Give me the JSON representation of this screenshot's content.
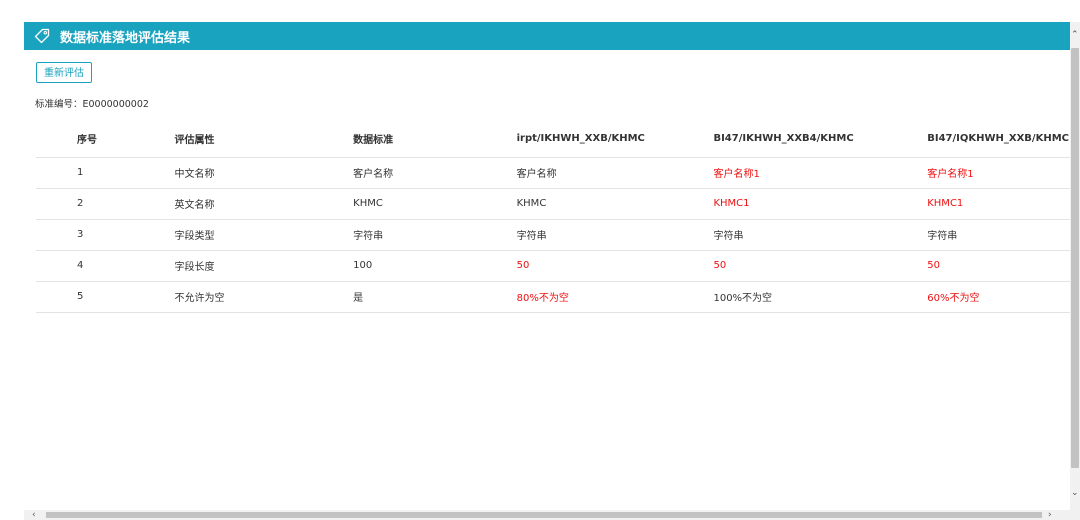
{
  "header": {
    "title": "数据标准落地评估结果",
    "icon": "tag-icon"
  },
  "actions": {
    "reevaluate_label": "重新评估"
  },
  "standard": {
    "code_text": "标准编号：E0000000002"
  },
  "colors": {
    "accent": "#1aa3bf",
    "mismatch": "#ee1111"
  },
  "table": {
    "headers": [
      "序号",
      "评估属性",
      "数据标准",
      "irpt/IKHWH_XXB/KHMC",
      "BI47/IKHWH_XXB4/KHMC",
      "BI47/IQKHWH_XXB/KHMC"
    ],
    "rows": [
      {
        "cells": [
          "1",
          "中文名称",
          "客户名称",
          "客户名称",
          "客户名称1",
          "客户名称1"
        ],
        "mismatch": [
          false,
          false,
          false,
          false,
          true,
          true
        ]
      },
      {
        "cells": [
          "2",
          "英文名称",
          "KHMC",
          "KHMC",
          "KHMC1",
          "KHMC1"
        ],
        "mismatch": [
          false,
          false,
          false,
          false,
          true,
          true
        ]
      },
      {
        "cells": [
          "3",
          "字段类型",
          "字符串",
          "字符串",
          "字符串",
          "字符串"
        ],
        "mismatch": [
          false,
          false,
          false,
          false,
          false,
          false
        ]
      },
      {
        "cells": [
          "4",
          "字段长度",
          "100",
          "50",
          "50",
          "50"
        ],
        "mismatch": [
          false,
          false,
          false,
          true,
          true,
          true
        ]
      },
      {
        "cells": [
          "5",
          "不允许为空",
          "是",
          "80%不为空",
          "100%不为空",
          "60%不为空"
        ],
        "mismatch": [
          false,
          false,
          false,
          true,
          false,
          true
        ]
      }
    ]
  }
}
